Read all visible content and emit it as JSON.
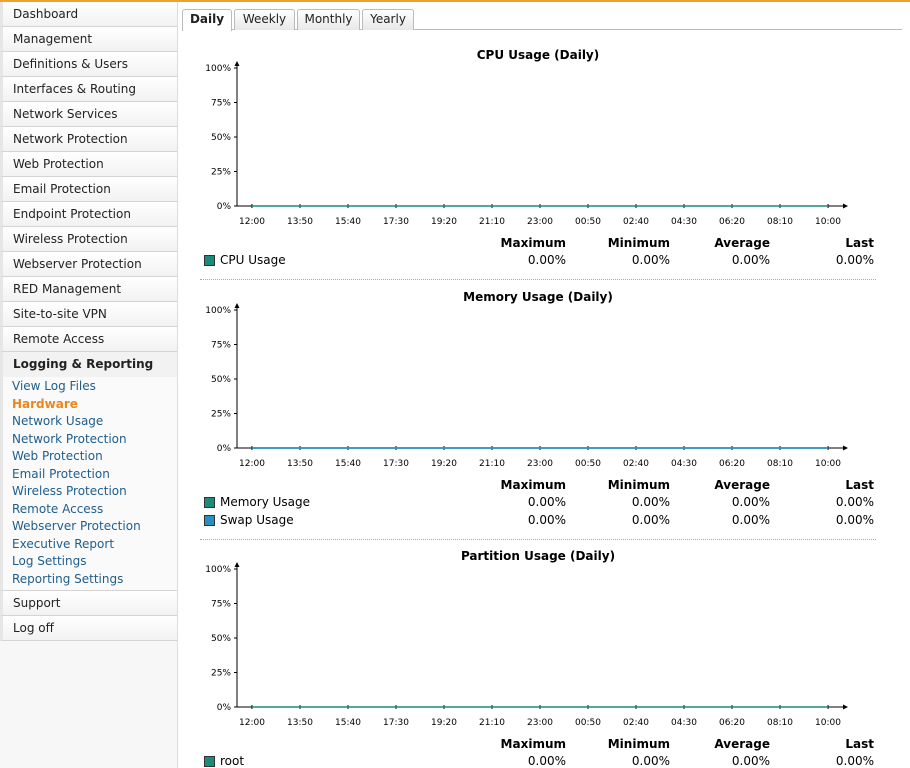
{
  "nav": {
    "items": [
      {
        "label": "Dashboard"
      },
      {
        "label": "Management"
      },
      {
        "label": "Definitions & Users"
      },
      {
        "label": "Interfaces & Routing"
      },
      {
        "label": "Network Services"
      },
      {
        "label": "Network Protection"
      },
      {
        "label": "Web Protection"
      },
      {
        "label": "Email Protection"
      },
      {
        "label": "Endpoint Protection"
      },
      {
        "label": "Wireless Protection"
      },
      {
        "label": "Webserver Protection"
      },
      {
        "label": "RED Management"
      },
      {
        "label": "Site-to-site VPN"
      },
      {
        "label": "Remote Access"
      }
    ],
    "active_section": "Logging & Reporting",
    "sub_items": [
      {
        "label": "View Log Files"
      },
      {
        "label": "Hardware"
      },
      {
        "label": "Network Usage"
      },
      {
        "label": "Network Protection"
      },
      {
        "label": "Web Protection"
      },
      {
        "label": "Email Protection"
      },
      {
        "label": "Wireless Protection"
      },
      {
        "label": "Remote Access"
      },
      {
        "label": "Webserver Protection"
      },
      {
        "label": "Executive Report"
      },
      {
        "label": "Log Settings"
      },
      {
        "label": "Reporting Settings"
      }
    ],
    "bottom_items": [
      {
        "label": "Support"
      },
      {
        "label": "Log off"
      }
    ]
  },
  "tabs": [
    {
      "label": "Daily"
    },
    {
      "label": "Weekly"
    },
    {
      "label": "Monthly"
    },
    {
      "label": "Yearly"
    }
  ],
  "stats_headers": {
    "max": "Maximum",
    "min": "Minimum",
    "avg": "Average",
    "last": "Last"
  },
  "colors": {
    "accent": "#e8871e",
    "series_teal": "#1a8a7a",
    "series_blue": "#2a8fc0",
    "link": "#1f5d8c"
  },
  "chart_data": [
    {
      "type": "line",
      "title": "CPU Usage (Daily)",
      "x": [
        "12:00",
        "13:50",
        "15:40",
        "17:30",
        "19:20",
        "21:10",
        "23:00",
        "00:50",
        "02:40",
        "04:30",
        "06:20",
        "08:10",
        "10:00"
      ],
      "y_ticks": [
        "0%",
        "25%",
        "50%",
        "75%",
        "100%"
      ],
      "ylim": [
        0,
        100
      ],
      "series": [
        {
          "name": "CPU Usage",
          "values": [
            0,
            0,
            0,
            0,
            0,
            0,
            0,
            0,
            0,
            0,
            0,
            0,
            0
          ],
          "max": "0.00%",
          "min": "0.00%",
          "avg": "0.00%",
          "last": "0.00%"
        }
      ]
    },
    {
      "type": "line",
      "title": "Memory Usage (Daily)",
      "x": [
        "12:00",
        "13:50",
        "15:40",
        "17:30",
        "19:20",
        "21:10",
        "23:00",
        "00:50",
        "02:40",
        "04:30",
        "06:20",
        "08:10",
        "10:00"
      ],
      "y_ticks": [
        "0%",
        "25%",
        "50%",
        "75%",
        "100%"
      ],
      "ylim": [
        0,
        100
      ],
      "series": [
        {
          "name": "Memory Usage",
          "values": [
            0,
            0,
            0,
            0,
            0,
            0,
            0,
            0,
            0,
            0,
            0,
            0,
            0
          ],
          "max": "0.00%",
          "min": "0.00%",
          "avg": "0.00%",
          "last": "0.00%"
        },
        {
          "name": "Swap Usage",
          "values": [
            0,
            0,
            0,
            0,
            0,
            0,
            0,
            0,
            0,
            0,
            0,
            0,
            0
          ],
          "max": "0.00%",
          "min": "0.00%",
          "avg": "0.00%",
          "last": "0.00%"
        }
      ]
    },
    {
      "type": "line",
      "title": "Partition Usage (Daily)",
      "x": [
        "12:00",
        "13:50",
        "15:40",
        "17:30",
        "19:20",
        "21:10",
        "23:00",
        "00:50",
        "02:40",
        "04:30",
        "06:20",
        "08:10",
        "10:00"
      ],
      "y_ticks": [
        "0%",
        "25%",
        "50%",
        "75%",
        "100%"
      ],
      "ylim": [
        0,
        100
      ],
      "series": [
        {
          "name": "root",
          "values": [
            0,
            0,
            0,
            0,
            0,
            0,
            0,
            0,
            0,
            0,
            0,
            0,
            0
          ],
          "max": "0.00%",
          "min": "0.00%",
          "avg": "0.00%",
          "last": "0.00%"
        }
      ]
    }
  ]
}
